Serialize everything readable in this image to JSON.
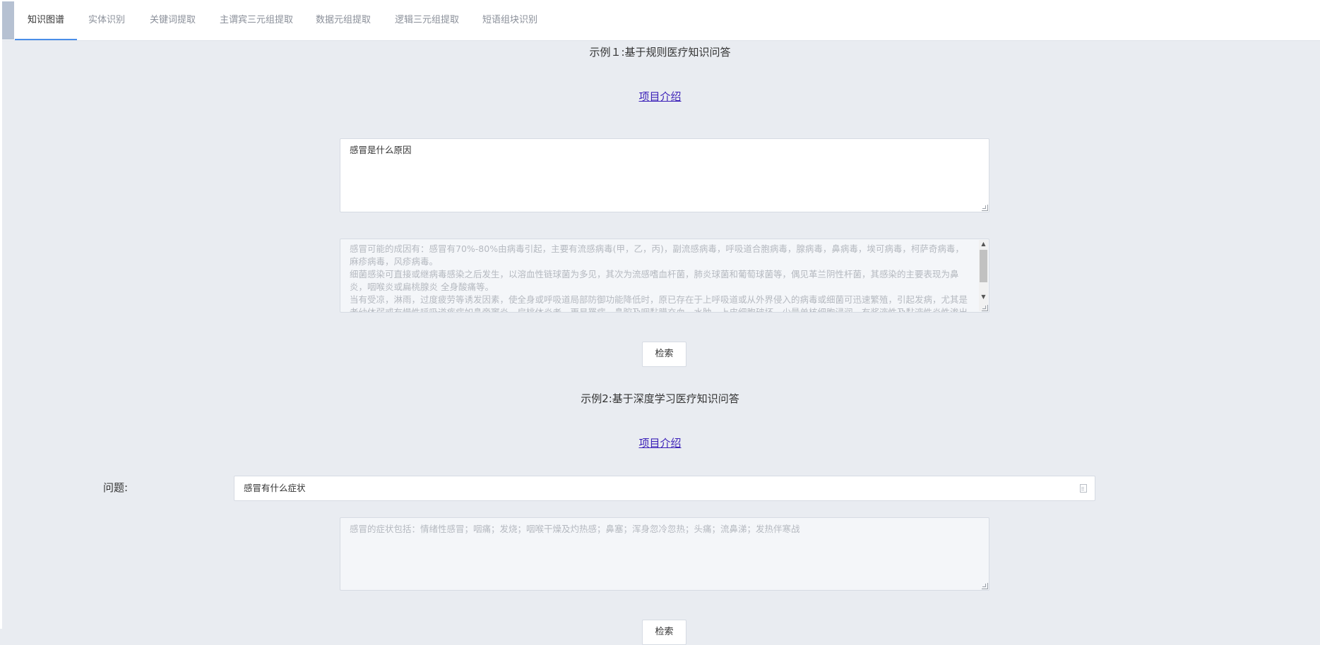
{
  "tabs": [
    {
      "label": "知识图谱",
      "active": true
    },
    {
      "label": "实体识别",
      "active": false
    },
    {
      "label": "关键词提取",
      "active": false
    },
    {
      "label": "主谓宾三元组提取",
      "active": false
    },
    {
      "label": "数据元组提取",
      "active": false
    },
    {
      "label": "逻辑三元组提取",
      "active": false
    },
    {
      "label": "短语组块识别",
      "active": false
    }
  ],
  "example1": {
    "title": "示例１:基于规则医疗知识问答",
    "intro_link": "项目介绍",
    "question": "感冒是什么原因",
    "answer_lines": [
      "感冒可能的成因有：感冒有70%-80%由病毒引起，主要有流感病毒(甲，乙，丙)，副流感病毒，呼吸道合胞病毒，腺病毒，鼻病毒，埃可病毒，柯萨奇病毒，麻疹病毒，风疹病毒。",
      "细菌感染可直接或继病毒感染之后发生，以溶血性链球菌为多见，其次为流感嗜血杆菌，肺炎球菌和葡萄球菌等，偶见革兰阴性杆菌，其感染的主要表现为鼻炎，咽喉炎或扁桃腺炎 全身酸痛等。",
      "当有受凉，淋雨，过度疲劳等诱发因素，使全身或呼吸道局部防御功能降低时，原已存在于上呼吸道或从外界侵入的病毒或细菌可迅速繁殖，引起发病，尤其是老幼体弱或有慢性呼吸道疾病如鼻旁窦炎，扁桃体炎者，更易罹病，鼻腔及咽黏膜充血，水肿，上皮细胞破坏，少量单核细胞浸润，有浆液性及黏液性炎性渗出"
    ],
    "search_button": "检索"
  },
  "example2": {
    "title": "示例2:基于深度学习医疗知识问答",
    "intro_link": "项目介绍",
    "question_label": "问题:",
    "question": "感冒有什么症状",
    "answer": "感冒的症状包括：情绪性感冒；咽痛；发烧；咽喉干燥及灼热感；鼻塞；浑身忽冷忽热；头痛；流鼻涕；发热伴寒战",
    "search_button": "检索"
  },
  "colors": {
    "page_bg": "#e9ecf1",
    "active_tab_underline": "#4a8ee8",
    "link": "#3a1fb8",
    "readonly_text": "#b5b9c0"
  }
}
